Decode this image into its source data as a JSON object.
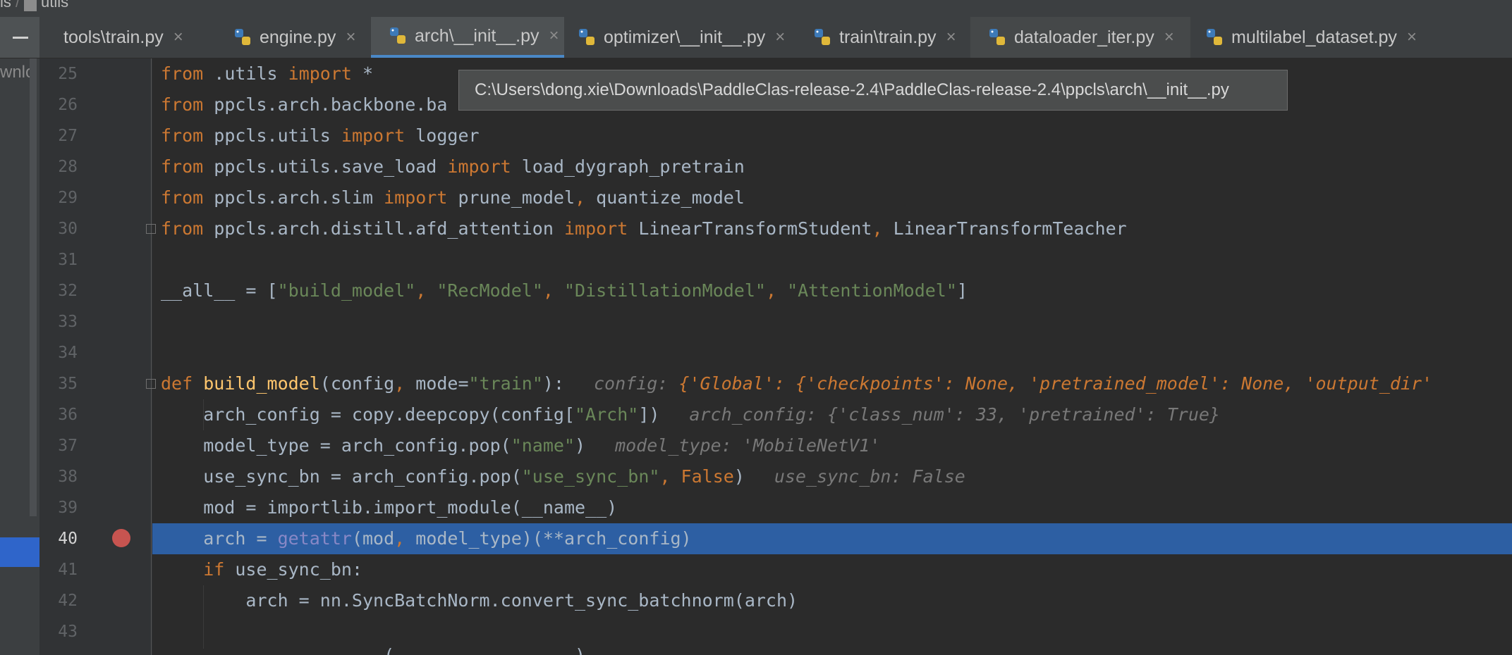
{
  "breadcrumb": {
    "left": "ls",
    "sep": "/",
    "folder": "utils"
  },
  "tabs": [
    {
      "label": "tools\\train.py"
    },
    {
      "label": "engine.py"
    },
    {
      "label": "arch\\__init__.py"
    },
    {
      "label": "optimizer\\__init__.py"
    },
    {
      "label": "train\\train.py"
    },
    {
      "label": "dataloader_iter.py"
    },
    {
      "label": "multilabel_dataset.py"
    }
  ],
  "tab_close_glyph": "×",
  "side_panel_fragment": "wnlo",
  "tooltip_path": "C:\\Users\\dong.xie\\Downloads\\PaddleClas-release-2.4\\PaddleClas-release-2.4\\ppcls\\arch\\__init__.py",
  "line_numbers": [
    "25",
    "26",
    "27",
    "28",
    "29",
    "30",
    "31",
    "32",
    "33",
    "34",
    "35",
    "36",
    "37",
    "38",
    "39",
    "40",
    "41",
    "42",
    "43"
  ],
  "code": {
    "l25": {
      "k1": "from",
      "a": " .utils ",
      "k2": "import",
      "b": " *"
    },
    "l26": {
      "k1": "from",
      "a": " ppcls.arch.backbone.ba"
    },
    "l27": {
      "k1": "from",
      "a": " ppcls.utils ",
      "k2": "import",
      "b": " logger"
    },
    "l28": {
      "k1": "from",
      "a": " ppcls.utils.save_load ",
      "k2": "import",
      "b": " load_dygraph_pretrain"
    },
    "l29": {
      "k1": "from",
      "a": " ppcls.arch.slim ",
      "k2": "import",
      "b": " prune_model",
      ",": ",",
      "c": " quantize_model"
    },
    "l30": {
      "k1": "from",
      "a": " ppcls.arch.distill.afd_attention ",
      "k2": "import",
      "b": " LinearTransformStudent",
      ",": ",",
      "c": " LinearTransformTeacher"
    },
    "l32": {
      "a": "__all__ = [",
      "s1": "\"build_model\"",
      "c1": ", ",
      "s2": "\"RecModel\"",
      "c2": ", ",
      "s3": "\"DistillationModel\"",
      "c3": ", ",
      "s4": "\"AttentionModel\"",
      "b": "]"
    },
    "l35": {
      "k": "def",
      "sp": " ",
      "fn": "build_model",
      "a": "(config",
      ",": ",",
      "b": " mode=",
      "s": "\"train\"",
      "c": "):",
      "h1": "config: ",
      "h2": "{'Global': {'checkpoints': None, 'pretrained_model': None, 'output_dir'"
    },
    "l36": {
      "a": "    arch_config = copy.deepcopy(config[",
      "s": "\"Arch\"",
      "b": "])",
      "h": "arch_config: {'class_num': 33, 'pretrained': True}"
    },
    "l37": {
      "a": "    model_type = arch_config.pop(",
      "s": "\"name\"",
      "b": ")",
      "h": "model_type: 'MobileNetV1'"
    },
    "l38": {
      "a": "    use_sync_bn = arch_config.pop(",
      "s": "\"use_sync_bn\"",
      ",": ",",
      "sp": " ",
      "k": "False",
      "b": ")",
      "h": "use_sync_bn: False"
    },
    "l39": {
      "a": "    mod = importlib.import_module(__name__)"
    },
    "l40": {
      "a": "    arch = ",
      "bi": "getattr",
      "b": "(mod",
      ",": ",",
      "c": " model_type)(**arch_config)"
    },
    "l41": {
      "ind": "    ",
      "k": "if",
      "a": " use_sync_bn:"
    },
    "l42": {
      "a": "        arch = nn.SyncBatchNorm.convert_sync_batchnorm(arch)"
    },
    "l44": {
      "a": "                     (                 )"
    }
  },
  "colors": {
    "background": "#2b2b2b",
    "keyword": "#cc7832",
    "string": "#6a8759",
    "function": "#ffc66d",
    "builtin": "#8888c6",
    "selection": "#2d5fa3",
    "breakpoint": "#c75450"
  }
}
